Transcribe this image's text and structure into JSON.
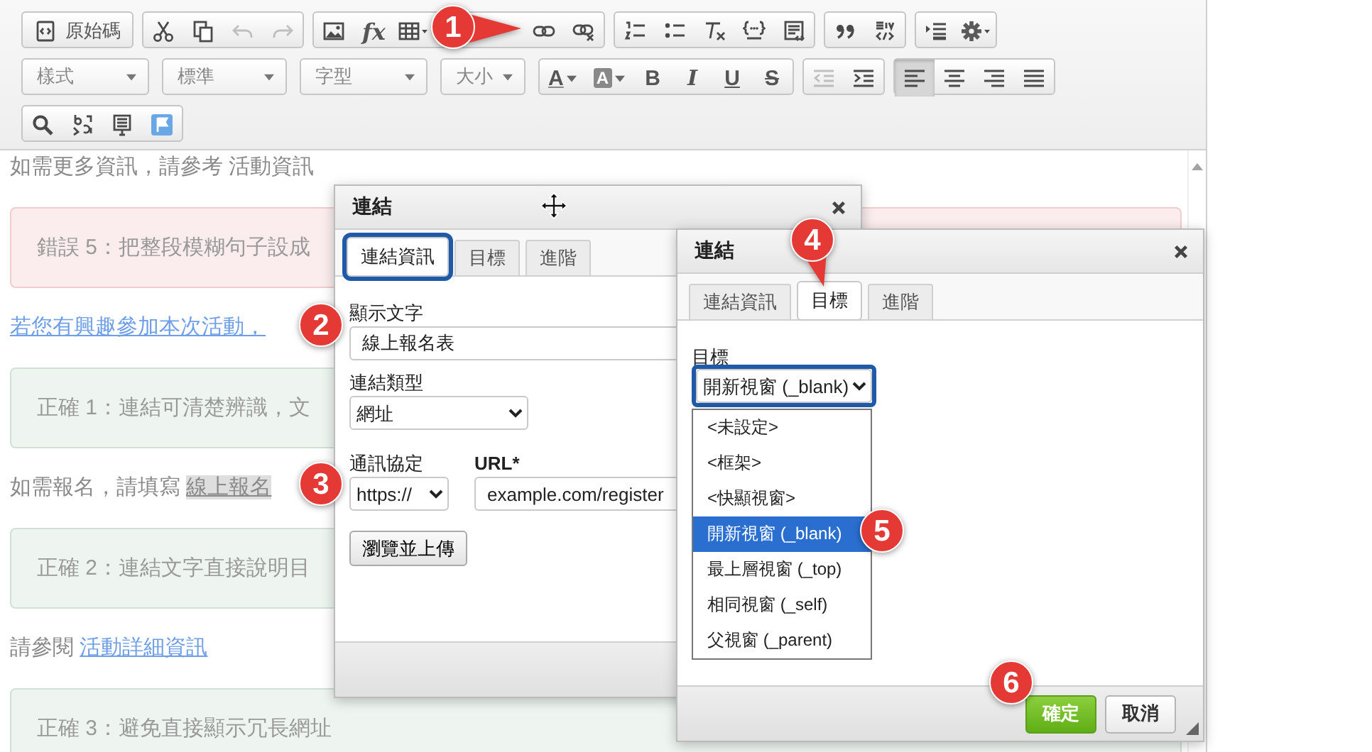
{
  "toolbar": {
    "rows": [
      [
        [
          {
            "kind": "labeled",
            "label": "原始碼",
            "disabled": false
          }
        ],
        [
          {
            "kind": "icon",
            "disabled": false
          },
          {
            "kind": "icon",
            "disabled": false
          },
          {
            "kind": "icon",
            "disabled": true
          },
          {
            "kind": "icon",
            "disabled": true
          }
        ],
        [
          {
            "kind": "icon",
            "disabled": false
          },
          {
            "kind": "fx",
            "text": "fx",
            "disabled": false
          },
          {
            "kind": "icon",
            "disabled": false
          },
          {
            "kind": "icon",
            "disabled": false
          },
          {
            "kind": "icon",
            "disabled": false
          }
        ],
        [
          {
            "kind": "icon",
            "disabled": false
          },
          {
            "kind": "icon",
            "disabled": false
          },
          {
            "kind": "icon",
            "disabled": false
          },
          {
            "kind": "icon",
            "disabled": false
          },
          {
            "kind": "icon",
            "disabled": false
          }
        ],
        [
          {
            "kind": "icon",
            "disabled": false
          },
          {
            "kind": "icon",
            "disabled": false
          }
        ],
        [
          {
            "kind": "icon",
            "disabled": false
          },
          {
            "kind": "icon",
            "disabled": false
          }
        ]
      ],
      [
        [
          {
            "kind": "combo",
            "placeholder": "樣式"
          }
        ],
        [
          {
            "kind": "combo",
            "placeholder": "標準"
          }
        ],
        [
          {
            "kind": "combo",
            "placeholder": "字型"
          }
        ],
        [
          {
            "kind": "combo",
            "placeholder": "大小"
          }
        ],
        [
          {
            "kind": "color",
            "text": "A",
            "disabled": false
          },
          {
            "kind": "bgcolor",
            "text": "A",
            "disabled": false
          },
          {
            "kind": "bold",
            "text": "B",
            "disabled": false
          },
          {
            "kind": "italic",
            "text": "I",
            "disabled": false
          },
          {
            "kind": "underline",
            "text": "U",
            "disabled": false
          },
          {
            "kind": "strike",
            "text": "S",
            "disabled": false
          }
        ],
        [
          {
            "kind": "icon",
            "disabled": true
          },
          {
            "kind": "icon",
            "disabled": false
          }
        ],
        [
          {
            "kind": "icon",
            "disabled": false,
            "pressed": true
          },
          {
            "kind": "icon",
            "disabled": false,
            "pressed": false
          },
          {
            "kind": "icon",
            "disabled": false,
            "pressed": false
          },
          {
            "kind": "icon",
            "disabled": false,
            "pressed": false
          }
        ]
      ],
      [
        [
          {
            "kind": "icon",
            "disabled": false
          },
          {
            "kind": "icon",
            "disabled": false
          },
          {
            "kind": "icon",
            "disabled": false
          },
          {
            "kind": "icon",
            "disabled": false
          }
        ]
      ]
    ]
  },
  "content": [
    {
      "kind": "para",
      "text": "如需更多資訊，請參考 活動資訊"
    },
    {
      "kind": "error",
      "text": "錯誤 5：把整段模糊句子設成"
    },
    {
      "kind": "linkline",
      "text": "若您有興趣參加本次活動，"
    },
    {
      "kind": "correct",
      "text": "正確 1：連結可清楚辨識，文"
    },
    {
      "kind": "para",
      "text": "如需報名，請填寫 ",
      "highlight": "線上報名"
    },
    {
      "kind": "correct",
      "text": "正確 2：連結文字直接說明目"
    },
    {
      "kind": "para",
      "text": "請參閱 ",
      "link": "活動詳細資訊"
    },
    {
      "kind": "correct",
      "text": "正確 3：避免直接顯示冗長網址"
    }
  ],
  "dialogs": [
    {
      "title": "連結",
      "move_cursor": true,
      "tabs": [
        {
          "label": "連結資訊",
          "selected": true,
          "focused": true
        },
        {
          "label": "目標",
          "selected": false,
          "focused": false
        },
        {
          "label": "進階",
          "selected": false,
          "focused": false
        }
      ],
      "fields": [
        {
          "kind": "text",
          "label": "顯示文字",
          "value": "線上報名表"
        },
        {
          "kind": "select",
          "label": "連結類型",
          "value": "網址"
        },
        {
          "kind": "protocol_url",
          "label": "通訊協定",
          "value": "https://",
          "url_label": "URL*",
          "url_value": "example.com/register"
        },
        {
          "kind": "button",
          "label": "瀏覽並上傳"
        }
      ]
    },
    {
      "title": "連結",
      "move_cursor": false,
      "tabs": [
        {
          "label": "連結資訊",
          "selected": false,
          "focused": false
        },
        {
          "label": "目標",
          "selected": true,
          "focused": false
        },
        {
          "label": "進階",
          "selected": false,
          "focused": false
        }
      ],
      "fields": [
        {
          "kind": "open_select",
          "label": "目標",
          "value": "開新視窗 (_blank)",
          "options": [
            {
              "label": "<未設定>",
              "selected": false
            },
            {
              "label": "<框架>",
              "selected": false
            },
            {
              "label": "<快顯視窗>",
              "selected": false
            },
            {
              "label": "開新視窗 (_blank)",
              "selected": true
            },
            {
              "label": "最上層視窗 (_top)",
              "selected": false
            },
            {
              "label": "相同視窗 (_self)",
              "selected": false
            },
            {
              "label": "父視窗 (_parent)",
              "selected": false
            }
          ]
        }
      ],
      "buttons": [
        {
          "label": "確定",
          "kind": "primary"
        },
        {
          "label": "取消",
          "kind": "normal"
        }
      ]
    }
  ],
  "callouts": [
    {
      "number": "1",
      "kind": "pointer-right"
    },
    {
      "number": "2",
      "kind": "plain"
    },
    {
      "number": "3",
      "kind": "plain"
    },
    {
      "number": "4",
      "kind": "pointer-down"
    },
    {
      "number": "5",
      "kind": "plain"
    },
    {
      "number": "6",
      "kind": "plain"
    }
  ]
}
